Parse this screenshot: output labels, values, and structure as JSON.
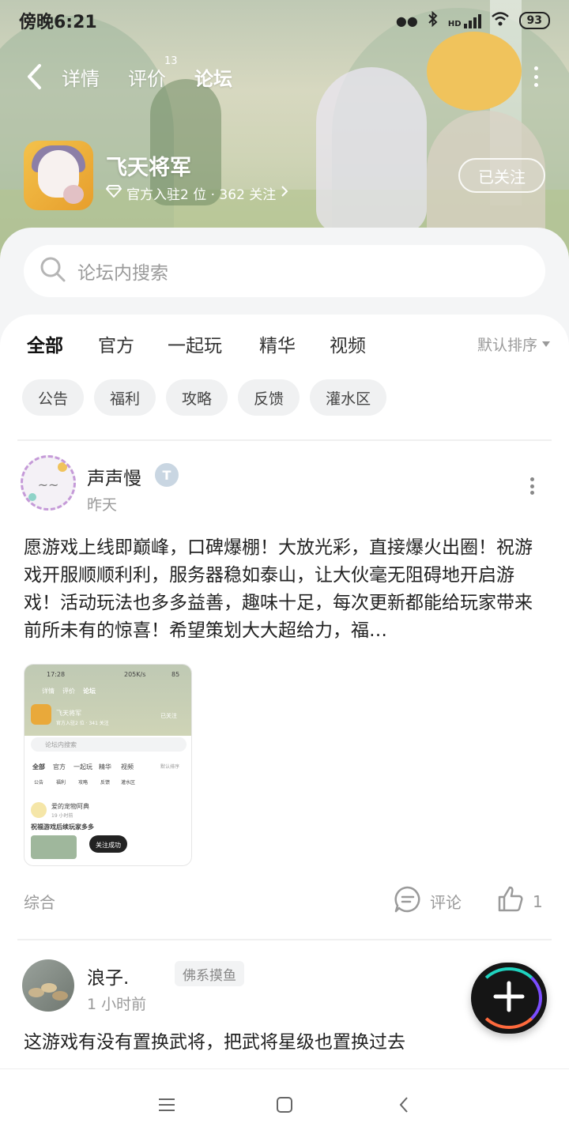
{
  "status_bar": {
    "time": "傍晚6:21",
    "network": "HD",
    "battery": "93"
  },
  "nav": {
    "tabs": [
      {
        "label": "详情"
      },
      {
        "label": "评价",
        "badge": "13"
      },
      {
        "label": "论坛",
        "active": true
      }
    ]
  },
  "game": {
    "name": "飞天将军",
    "meta": "官方入驻2 位 · 362 关注",
    "follow_label": "已关注"
  },
  "search": {
    "placeholder": "论坛内搜索"
  },
  "category_tabs": [
    {
      "label": "全部",
      "active": true
    },
    {
      "label": "官方"
    },
    {
      "label": "一起玩"
    },
    {
      "label": "精华"
    },
    {
      "label": "视频"
    }
  ],
  "sort_label": "默认排序",
  "chips": [
    "公告",
    "福利",
    "攻略",
    "反馈",
    "灌水区"
  ],
  "posts": [
    {
      "author": "声声慢",
      "time": "昨天",
      "text": "愿游戏上线即巅峰，口碑爆棚！大放光彩，直接爆火出圈！祝游戏开服顺顺利利，服务器稳如泰山，让大伙毫无阻碍地开启游戏！活动玩法也多多益善，趣味十足，每次更新都能给玩家带来前所未有的惊喜！希望策划大大超给力，福…",
      "thumbnail": {
        "time": "17:28",
        "net": "205K/s",
        "battery": "85",
        "tabs": [
          "详情",
          "评价",
          "论坛"
        ],
        "game": "飞天将军",
        "meta": "官方入驻2 位 · 341 关注",
        "follow": "已关注",
        "search": "论坛内搜索",
        "cats": [
          "全部",
          "官方",
          "一起玩",
          "精华",
          "视频"
        ],
        "sort": "默认排序",
        "chips": [
          "公告",
          "福利",
          "攻略",
          "反馈",
          "灌水区"
        ],
        "author": "爱的宠物阿典",
        "post_time": "19 小时前",
        "post_text": "祝福游戏后续玩家多多",
        "toast": "关注成功"
      },
      "category": "综合",
      "comment_label": "评论",
      "likes": "1"
    },
    {
      "author": "浪子.",
      "tag": "佛系摸鱼",
      "time": "1 小时前",
      "text": "这游戏有没有置换武将，把武将星级也置换过去"
    }
  ],
  "icons": {
    "back": "chevron-left-icon",
    "more": "more-vertical-icon",
    "diamond": "diamond-icon",
    "search": "search-icon",
    "comment": "comment-icon",
    "like": "thumbs-up-icon",
    "fab": "plus-icon"
  },
  "colors": {
    "accent": "#14c7b8",
    "text_primary": "#222222",
    "text_secondary": "#999999"
  }
}
